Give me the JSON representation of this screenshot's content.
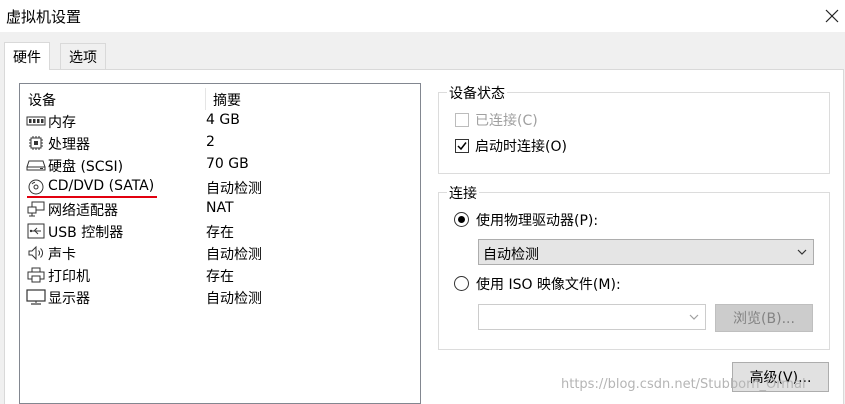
{
  "window": {
    "title": "虚拟机设置",
    "close_icon": "close-icon"
  },
  "tabs": [
    {
      "label": "硬件",
      "active": true
    },
    {
      "label": "选项",
      "active": false
    }
  ],
  "device_list": {
    "columns": [
      "设备",
      "摘要"
    ],
    "rows": [
      {
        "icon": "memory-icon",
        "name": "内存",
        "summary": "4 GB"
      },
      {
        "icon": "processor-icon",
        "name": "处理器",
        "summary": "2"
      },
      {
        "icon": "harddisk-icon",
        "name": "硬盘 (SCSI)",
        "summary": "70 GB"
      },
      {
        "icon": "cd-dvd-icon",
        "name": "CD/DVD (SATA)",
        "summary": "自动检测",
        "highlighted": true
      },
      {
        "icon": "network-adapter-icon",
        "name": "网络适配器",
        "summary": "NAT"
      },
      {
        "icon": "usb-icon",
        "name": "USB 控制器",
        "summary": "存在"
      },
      {
        "icon": "sound-card-icon",
        "name": "声卡",
        "summary": "自动检测"
      },
      {
        "icon": "printer-icon",
        "name": "打印机",
        "summary": "存在"
      },
      {
        "icon": "display-icon",
        "name": "显示器",
        "summary": "自动检测"
      }
    ]
  },
  "device_status": {
    "title": "设备状态",
    "connected": {
      "label": "已连接(C)",
      "checked": false,
      "enabled": false
    },
    "connect_at_power_on": {
      "label": "启动时连接(O)",
      "checked": true,
      "enabled": true
    }
  },
  "connection": {
    "title": "连接",
    "physical_drive": {
      "label": "使用物理驱动器(P):",
      "selected": true,
      "value": "自动检测"
    },
    "iso_image": {
      "label": "使用 ISO 映像文件(M):",
      "selected": false,
      "value": ""
    },
    "browse_label": "浏览(B)..."
  },
  "advanced_label": "高级(V)...",
  "watermark": "https://blog.csdn.net/Stubborn_Ormal",
  "colors": {
    "accent_red": "#e2000f",
    "dialog_bg": "#f0f0f0"
  }
}
